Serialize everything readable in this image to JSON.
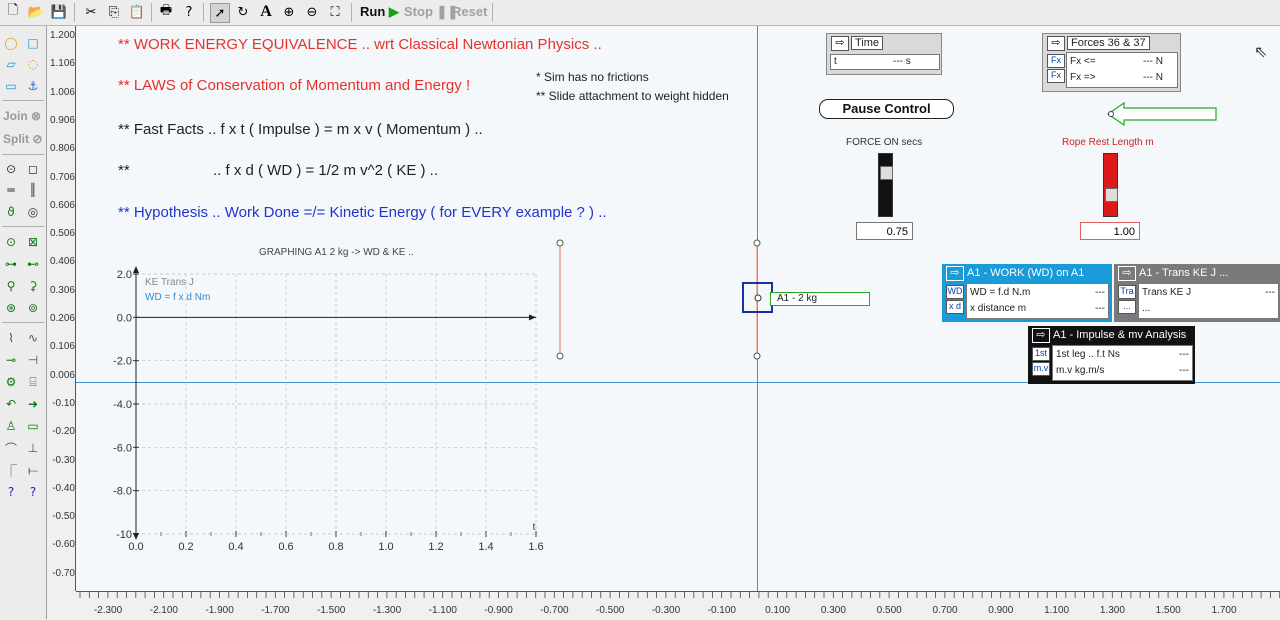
{
  "toolbar": {
    "run": "Run",
    "stop": "Stop",
    "reset": "Reset"
  },
  "palette": {
    "join": "Join",
    "split": "Split"
  },
  "vruler": [
    "1.200",
    "1.106",
    "1.006",
    "0.906",
    "0.806",
    "0.706",
    "0.606",
    "0.506",
    "0.406",
    "0.306",
    "0.206",
    "0.106",
    "0.006",
    "-0.10",
    "-0.20",
    "-0.30",
    "-0.40",
    "-0.50",
    "-0.60",
    "-0.70"
  ],
  "hruler": [
    "-2.300",
    "-2.100",
    "-1.900",
    "-1.700",
    "-1.500",
    "-1.300",
    "-1.100",
    "-0.900",
    "-0.700",
    "-0.500",
    "-0.300",
    "-0.100",
    "0.100",
    "0.300",
    "0.500",
    "0.700",
    "0.900",
    "1.100",
    "1.300",
    "1.500",
    "1.700"
  ],
  "text": {
    "line1": "** WORK ENERGY EQUIVALENCE .. wrt Classical Newtonian Physics ..",
    "line2": "** LAWS of Conservation of Momentum and Energy !",
    "note1": "* Sim has no frictions",
    "note2": "** Slide attachment to weight hidden",
    "line3": "** Fast Facts .. f x t  ( Impulse )  =  m x v  ( Momentum )  ..",
    "line4a": "**",
    "line4b": ".. f x d  ( WD )  =  1/2 m v^2  ( KE )  ..",
    "line5": "** Hypothesis .. Work Done =/= Kinetic Energy  ( for EVERY example  ? )  .."
  },
  "graph": {
    "title": "GRAPHING A1 2 kg -> WD & KE ..",
    "legend1": "KE Trans J",
    "legend2": "WD = f x d Nm",
    "x_label": "t"
  },
  "chart_data": {
    "type": "line",
    "title": "GRAPHING A1 2 kg -> WD & KE ..",
    "xlabel": "t",
    "ylabel": "",
    "xlim": [
      0.0,
      1.6
    ],
    "ylim": [
      -10,
      2.0
    ],
    "x_ticks": [
      "0.0",
      "0.2",
      "0.4",
      "0.6",
      "0.8",
      "1.0",
      "1.2",
      "1.4",
      "1.6"
    ],
    "y_ticks": [
      "2.0",
      "0.0",
      "-2.0",
      "-4.0",
      "-6.0",
      "-8.0",
      "-10"
    ],
    "series": [
      {
        "name": "KE Trans J",
        "x": [],
        "y": []
      },
      {
        "name": "WD = f x d Nm",
        "x": [],
        "y": []
      }
    ],
    "grid": true,
    "legend": "top-left"
  },
  "time_meter": {
    "header": "Time",
    "field_label": "t",
    "field_value": "--- s"
  },
  "forces_meter": {
    "header": "Forces 36 & 37",
    "rows": [
      {
        "tag": "Fx",
        "label": "Fx <=",
        "value": "--- N"
      },
      {
        "tag": "Fx",
        "label": "Fx =>",
        "value": "--- N"
      }
    ]
  },
  "pause_button": "Pause Control",
  "force_on": {
    "label": "FORCE ON secs",
    "value": "0.75",
    "level": 0.75
  },
  "rope_rest": {
    "label": "Rope Rest Length m",
    "value": "1.00",
    "level": 0.3
  },
  "body_label": "A1 - 2 kg",
  "work_meter": {
    "header": "A1 - WORK (WD) on A1",
    "rows": [
      {
        "tag": "WD",
        "label": "WD = f.d N.m",
        "value": "---"
      },
      {
        "tag": "x d",
        "label": "x distance m",
        "value": "---"
      }
    ]
  },
  "ke_meter": {
    "header": "A1 - Trans KE J ...",
    "rows": [
      {
        "tag": "Tra",
        "label": "Trans KE J",
        "value": "---"
      },
      {
        "tag": "...",
        "label": "...",
        "value": ""
      }
    ]
  },
  "impulse_meter": {
    "header": "A1 - Impulse & mv Analysis",
    "rows": [
      {
        "tag": "1st",
        "label": "1st leg .. f.t Ns",
        "value": "---"
      },
      {
        "tag": "m.v",
        "label": "m.v kg.m/s",
        "value": "---"
      }
    ]
  },
  "colors": {
    "red_text": "#e8312a",
    "blue_text": "#2233cc",
    "graph_legend_blue": "#2a8fd0",
    "meter_blue": "#1a9ad8",
    "meter_gray": "#7a7a7a",
    "meter_black": "#111111",
    "green": "#22aa22"
  }
}
